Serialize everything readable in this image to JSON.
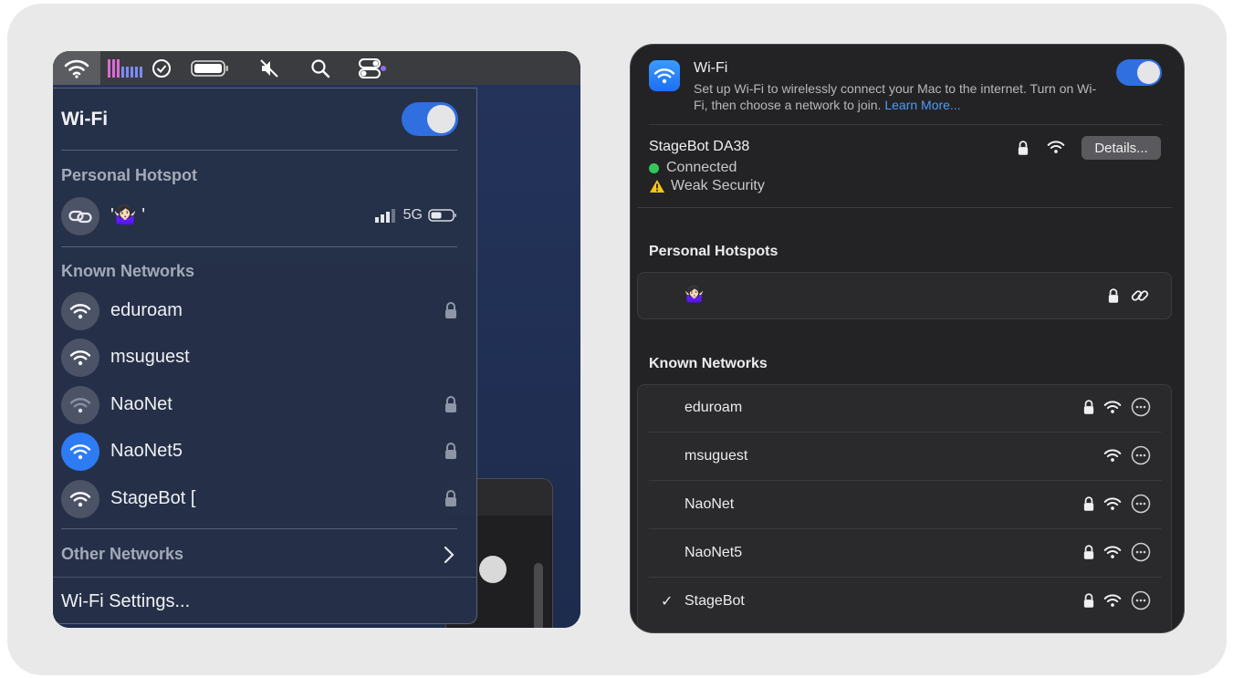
{
  "left_menu": {
    "title": "Wi-Fi",
    "toggle_on": true,
    "personal_hotspot": {
      "label": "Personal Hotspot",
      "device_name": "'🤷🏻‍♀️ '",
      "network_type": "5G"
    },
    "known_networks_label": "Known Networks",
    "known_networks": [
      {
        "name": "eduroam",
        "locked": true,
        "active": false
      },
      {
        "name": "msuguest",
        "locked": false,
        "active": false
      },
      {
        "name": "NaoNet",
        "locked": true,
        "active": false
      },
      {
        "name": "NaoNet5",
        "locked": true,
        "active": true
      },
      {
        "name": "StageBot [",
        "locked": true,
        "active": false
      }
    ],
    "other_networks_label": "Other Networks",
    "wifi_settings_label": "Wi-Fi Settings..."
  },
  "settings_panel": {
    "title": "Wi-Fi",
    "description": "Set up Wi-Fi to wirelessly connect your Mac to the internet. Turn on Wi-Fi, then choose a network to join.",
    "learn_more": "Learn More...",
    "toggle_on": true,
    "current_network": {
      "name": "StageBot DA38",
      "status": "Connected",
      "security": "Weak Security",
      "details_button": "Details..."
    },
    "personal_hotspots_label": "Personal Hotspots",
    "hotspot_name": "🤷🏻‍♀️",
    "known_networks_label": "Known Networks",
    "known_networks": [
      {
        "name": "eduroam",
        "locked": true,
        "checked": false
      },
      {
        "name": "msuguest",
        "locked": false,
        "checked": false
      },
      {
        "name": "NaoNet",
        "locked": true,
        "checked": false
      },
      {
        "name": "NaoNet5",
        "locked": true,
        "checked": false
      },
      {
        "name": "StageBot",
        "locked": true,
        "checked": true
      }
    ],
    "checkmark": "✓"
  },
  "colors": {
    "accent": "#2f6fe0",
    "connected": "#33c759",
    "warning": "#f5c518",
    "link": "#4b9bff"
  }
}
